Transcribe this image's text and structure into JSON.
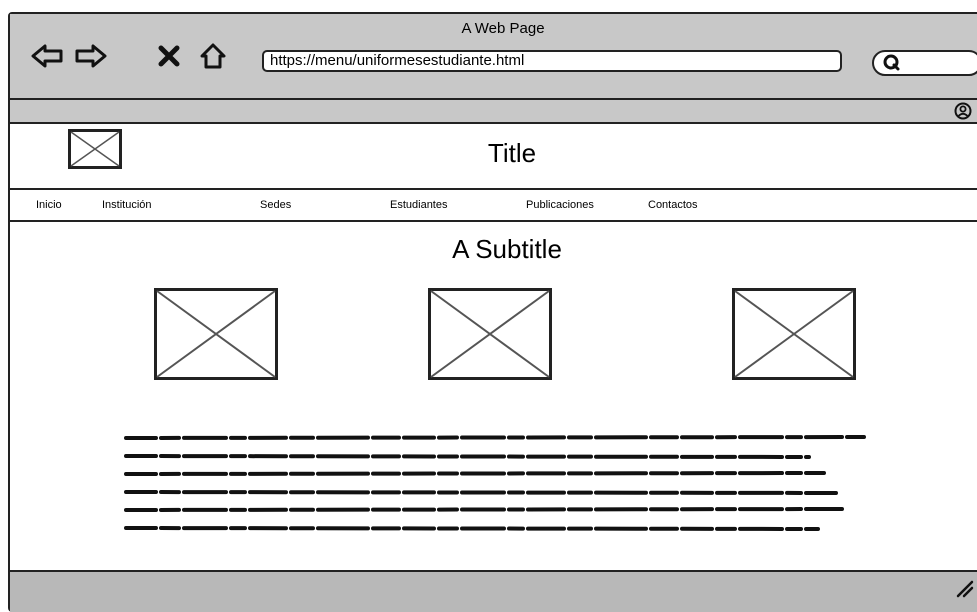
{
  "window": {
    "title": "A Web Page"
  },
  "browser": {
    "url": "https://menu/uniformesestudiante.html",
    "nav_icons": [
      "back-arrow-icon",
      "forward-arrow-icon",
      "close-icon",
      "home-icon"
    ],
    "search_icon": "search-icon",
    "user_icon": "user-icon"
  },
  "page": {
    "title": "Title",
    "subtitle": "A Subtitle",
    "menu": [
      {
        "label": "Inicio"
      },
      {
        "label": "Institución"
      },
      {
        "label": "Sedes"
      },
      {
        "label": "Estudiantes"
      },
      {
        "label": "Publicaciones"
      },
      {
        "label": "Contactos"
      }
    ],
    "image_placeholders": 3,
    "text_block_lines": 6
  },
  "colors": {
    "chrome": "#c8c8c8",
    "border": "#222222",
    "placeholder": "#555555",
    "bottom_bar": "#b8b8b8"
  }
}
